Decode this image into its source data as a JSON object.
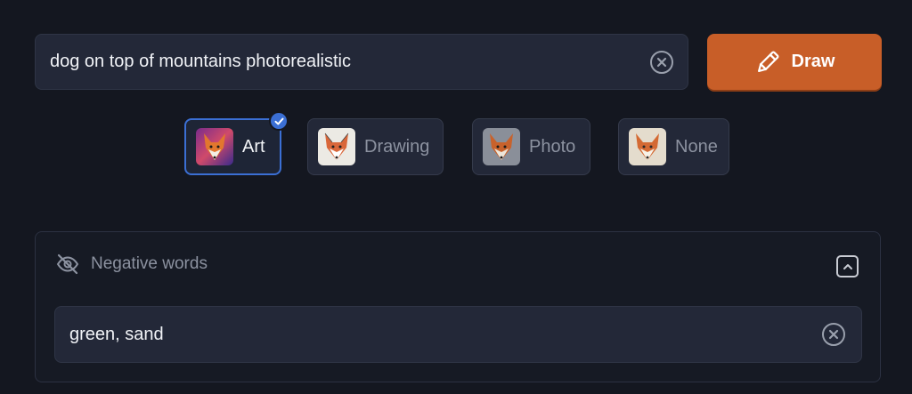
{
  "prompt": {
    "value": "dog on top of mountains photorealistic",
    "clear_icon": "x-circle-icon"
  },
  "draw_button": {
    "label": "Draw",
    "icon": "pencil-icon",
    "color": "#c85e28"
  },
  "styles": [
    {
      "label": "Art",
      "selected": true,
      "icon": "fox-art-thumbnail"
    },
    {
      "label": "Drawing",
      "selected": false,
      "icon": "fox-drawing-thumbnail"
    },
    {
      "label": "Photo",
      "selected": false,
      "icon": "fox-photo-thumbnail"
    },
    {
      "label": "None",
      "selected": false,
      "icon": "fox-none-thumbnail"
    }
  ],
  "negative": {
    "title": "Negative words",
    "icon": "eye-off-icon",
    "collapse_icon": "chevron-up-icon",
    "value": "green, sand"
  },
  "colors": {
    "background": "#141720",
    "accent": "#3b6fd4",
    "field": "#232838"
  }
}
